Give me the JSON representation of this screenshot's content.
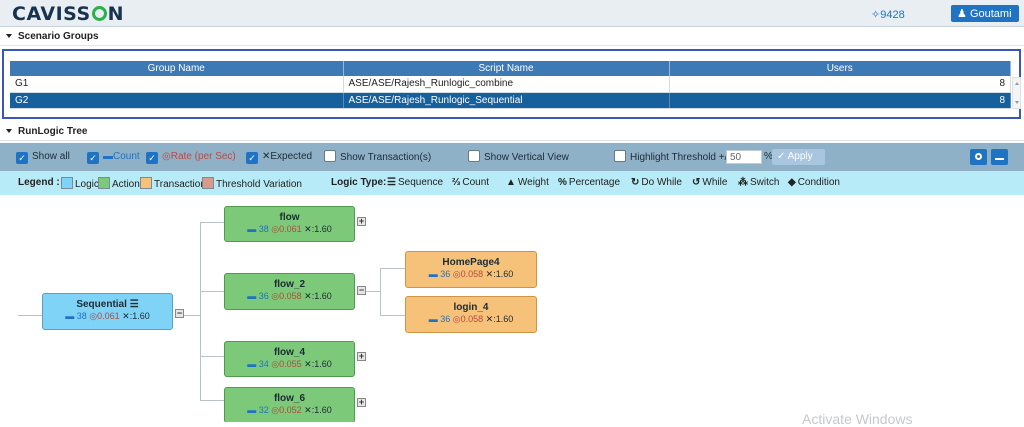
{
  "app": {
    "logo": "CAVISS",
    "logo_tail": "N"
  },
  "header": {
    "count_label": "✧9428",
    "user_label": "Goutami"
  },
  "scenario_groups": {
    "title": "Scenario Groups",
    "columns": [
      "Group Name",
      "Script Name",
      "Users"
    ],
    "rows": [
      {
        "group": "G1",
        "script": "ASE/ASE/Rajesh_Runlogic_combine",
        "users": "8"
      },
      {
        "group": "G2",
        "script": "ASE/ASE/Rajesh_Runlogic_Sequential",
        "users": "8"
      }
    ]
  },
  "runlogic": {
    "title": "RunLogic Tree",
    "toolbar": {
      "show_all": "Show all",
      "count": "Count",
      "rate": "Rate (per Sec)",
      "expected": "Expected",
      "show_transactions": "Show Transaction(s)",
      "show_vertical": "Show Vertical View",
      "highlight_threshold": "Highlight Threshold +/-",
      "threshold_value": "50",
      "percent": "%",
      "apply": "Apply",
      "checked": {
        "show_all": true,
        "count": true,
        "rate": true,
        "expected": true,
        "show_transactions": false,
        "show_vertical": false,
        "highlight_threshold": false
      }
    },
    "legend": {
      "label": "Legend :",
      "items": [
        {
          "label": "Logic",
          "color": "#7ed3f7"
        },
        {
          "label": "Action",
          "color": "#7cc97a"
        },
        {
          "label": "Transaction",
          "color": "#f6c27a"
        },
        {
          "label": "Threshold Variation",
          "color": "#d99a8c"
        }
      ],
      "logic_type_label": "Logic Type:",
      "logic_types": [
        {
          "icon": "sequence-icon",
          "label": "Sequence"
        },
        {
          "icon": "count-icon",
          "label": "Count"
        },
        {
          "icon": "weight-icon",
          "label": "Weight"
        },
        {
          "icon": "percentage-icon",
          "label": "Percentage"
        },
        {
          "icon": "do-while-icon",
          "label": "Do While"
        },
        {
          "icon": "while-icon",
          "label": "While"
        },
        {
          "icon": "switch-icon",
          "label": "Switch"
        },
        {
          "icon": "condition-icon",
          "label": "Condition"
        }
      ]
    },
    "nodes": {
      "sequential": {
        "name": "Sequential",
        "count": "38",
        "rate": "0.061",
        "expected": "1.60"
      },
      "flow": {
        "name": "flow",
        "count": "38",
        "rate": "0.061",
        "expected": "1.60"
      },
      "flow_2": {
        "name": "flow_2",
        "count": "36",
        "rate": "0.058",
        "expected": "1.60"
      },
      "flow_4": {
        "name": "flow_4",
        "count": "34",
        "rate": "0.055",
        "expected": "1.60"
      },
      "flow_6": {
        "name": "flow_6",
        "count": "32",
        "rate": "0.052",
        "expected": "1.60"
      },
      "homepage4": {
        "name": "HomePage4",
        "count": "36",
        "rate": "0.058",
        "expected": "1.60"
      },
      "login_4": {
        "name": "login_4",
        "count": "36",
        "rate": "0.058",
        "expected": "1.60"
      }
    }
  },
  "watermark": "Activate Windows"
}
